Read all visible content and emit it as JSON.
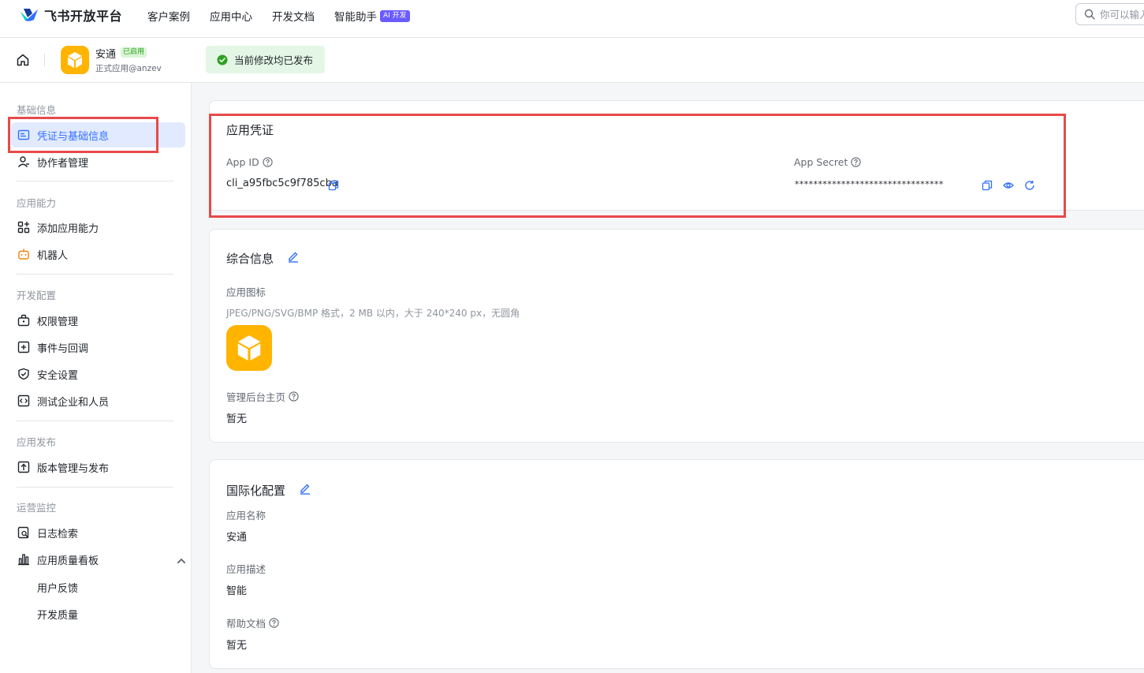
{
  "brand": {
    "name": "飞书开放平台"
  },
  "nav": {
    "links": [
      "客户案例",
      "应用中心",
      "开发文档",
      "智能助手"
    ],
    "ai_badge": "AI 开发",
    "search_placeholder": "你可以输入"
  },
  "app": {
    "name": "安通",
    "status": "已启用",
    "subtitle": "正式应用@anzev",
    "publish_status": "当前修改均已发布"
  },
  "sidebar": {
    "sections": [
      {
        "title": "基础信息",
        "items": [
          "凭证与基础信息",
          "协作者管理"
        ]
      },
      {
        "title": "应用能力",
        "items": [
          "添加应用能力",
          "机器人"
        ]
      },
      {
        "title": "开发配置",
        "items": [
          "权限管理",
          "事件与回调",
          "安全设置",
          "测试企业和人员"
        ]
      },
      {
        "title": "应用发布",
        "items": [
          "版本管理与发布"
        ]
      },
      {
        "title": "运营监控",
        "items": [
          "日志检索",
          "应用质量看板",
          "用户反馈",
          "开发质量"
        ]
      }
    ],
    "active_item": "凭证与基础信息"
  },
  "credentials": {
    "title": "应用凭证",
    "app_id_label": "App ID",
    "app_id": "cli_a95fbc5c9f785cba",
    "app_secret_label": "App Secret",
    "app_secret": "********************************"
  },
  "general": {
    "title": "综合信息",
    "icon_label": "应用图标",
    "icon_hint": "JPEG/PNG/SVG/BMP 格式，2 MB 以内，大于 240*240 px，无圆角",
    "homepage_label": "管理后台主页",
    "homepage_value": "暂无"
  },
  "i18n": {
    "title": "国际化配置",
    "name_label": "应用名称",
    "name_value": "安通",
    "desc_label": "应用描述",
    "desc_value": "智能",
    "help_label": "帮助文档",
    "help_value": "暂无"
  },
  "colors": {
    "accent": "#3370ff",
    "app_icon": "#ffb400",
    "highlight": "#e84a4a",
    "success": "#2ea121"
  }
}
